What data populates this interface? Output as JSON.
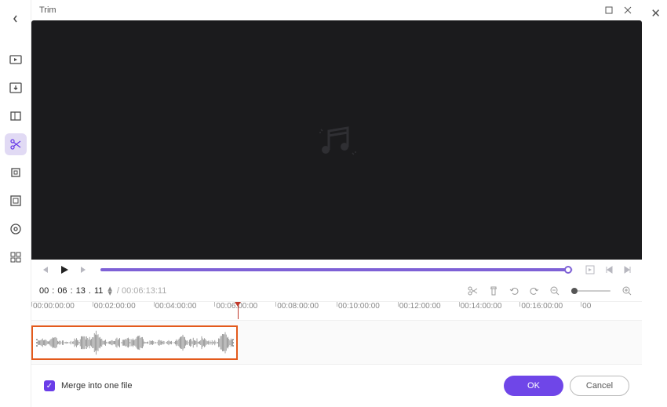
{
  "dialog": {
    "title": "Trim"
  },
  "playback": {
    "progress_percent": 99
  },
  "time": {
    "hh": "00",
    "mm": "06",
    "ss": "13",
    "ff": "11",
    "total": "00:06:13:11"
  },
  "ruler": {
    "ticks": [
      "00:00:00:00",
      "00:02:00:00",
      "00:04:00:00",
      "00:06:00:00",
      "00:08:00:00",
      "00:10:00:00",
      "00:12:00:00",
      "00:14:00:00",
      "00:16:00:00",
      "00"
    ]
  },
  "footer": {
    "merge_label": "Merge into one file",
    "ok": "OK",
    "cancel": "Cancel"
  }
}
